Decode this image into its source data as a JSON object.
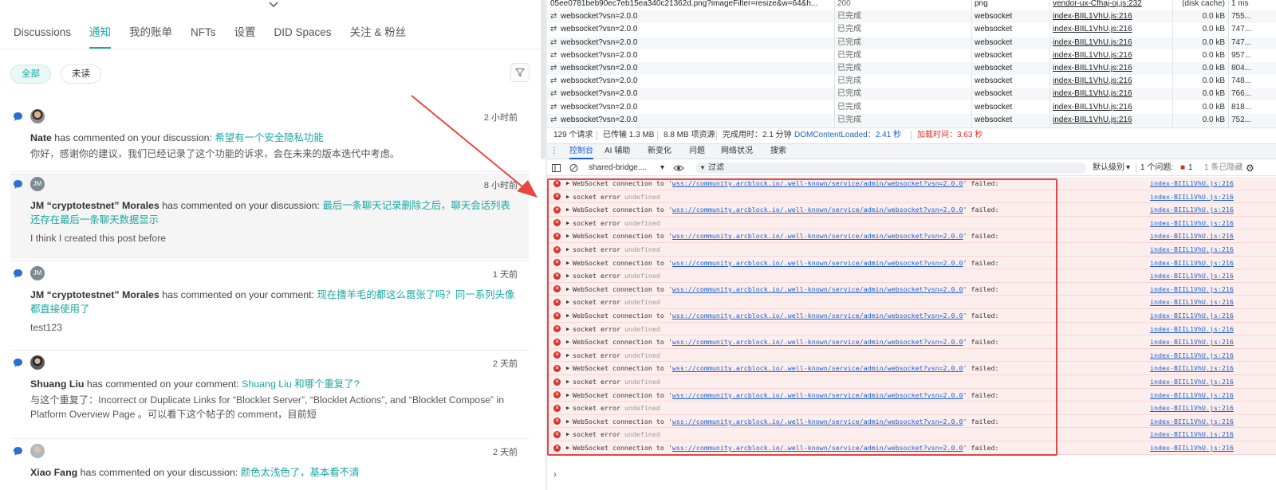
{
  "left": {
    "tabs": [
      {
        "label": "Discussions",
        "active": false
      },
      {
        "label": "通知",
        "active": true
      },
      {
        "label": "我的账单",
        "active": false
      },
      {
        "label": "NFTs",
        "active": false
      },
      {
        "label": "设置",
        "active": false
      },
      {
        "label": "DID Spaces",
        "active": false
      },
      {
        "label": "关注 & 粉丝",
        "active": false
      }
    ],
    "filters": {
      "all": "全部",
      "unread": "未读"
    },
    "accent_color": "#1aa7a3",
    "notifications": [
      {
        "avatar": "photo",
        "initials": "",
        "time": "2 小时前",
        "author": "Nate",
        "action": " has commented on your discussion: ",
        "link": "希望有一个安全隐私功能",
        "body": "你好，感谢你的建议，我们已经记录了这个功能的诉求，会在未来的版本迭代中考虑。",
        "highlighted": false
      },
      {
        "avatar": "init",
        "initials": "JM",
        "time": "8 小时前",
        "author": "JM “cryptotestnet” Morales",
        "action": " has commented on your discussion: ",
        "link": "最后一条聊天记录删除之后，聊天会话列表还存在最后一条聊天数据显示",
        "body": "I think I created this post before",
        "highlighted": true
      },
      {
        "avatar": "init",
        "initials": "JM",
        "time": "1 天前",
        "author": "JM “cryptotestnet” Morales",
        "action": " has commented on your comment: ",
        "link": "现在撸羊毛的都这么嚣张了吗？同一系列头像都直接使用了",
        "body": "test123",
        "highlighted": false
      },
      {
        "avatar": "photo2",
        "initials": "",
        "time": "2 天前",
        "author": "Shuang Liu",
        "action": " has commented on your comment: ",
        "link": "Shuang Liu 和哪个重复了?",
        "body": "与这个重复了：Incorrect or Duplicate Links for “Blocklet Server”, “Blocklet Actions”, and “Blocklet Compose” in Platform Overview Page 。可以看下这个帖子的 comment，目前短",
        "highlighted": false
      },
      {
        "avatar": "photo3",
        "initials": "",
        "time": "2 天前",
        "author": "Xiao Fang",
        "action": " has commented on your discussion: ",
        "link": "颜色太浅色了，基本看不清",
        "body": "",
        "highlighted": false
      }
    ]
  },
  "devtools": {
    "network_rows": [
      {
        "name": "05ee0781beb90ec7eb15ea340c21362d.png?imageFilter=resize&w=64&h...",
        "status": "200",
        "type": "png",
        "initiator": "vendor-ux-Cfhaj-oj.js:232",
        "size": "(disk cache)",
        "time": "1 ms"
      },
      {
        "name": "websocket?vsn=2.0.0",
        "status": "已完成",
        "type": "websocket",
        "initiator": "index-BIIL1VhU.js:216",
        "size": "0.0 kB",
        "time": "755..."
      },
      {
        "name": "websocket?vsn=2.0.0",
        "status": "已完成",
        "type": "websocket",
        "initiator": "index-BIIL1VhU.js:216",
        "size": "0.0 kB",
        "time": "747..."
      },
      {
        "name": "websocket?vsn=2.0.0",
        "status": "已完成",
        "type": "websocket",
        "initiator": "index-BIIL1VhU.js:216",
        "size": "0.0 kB",
        "time": "747..."
      },
      {
        "name": "websocket?vsn=2.0.0",
        "status": "已完成",
        "type": "websocket",
        "initiator": "index-BIIL1VhU.js:216",
        "size": "0.0 kB",
        "time": "957..."
      },
      {
        "name": "websocket?vsn=2.0.0",
        "status": "已完成",
        "type": "websocket",
        "initiator": "index-BIIL1VhU.js:216",
        "size": "0.0 kB",
        "time": "804..."
      },
      {
        "name": "websocket?vsn=2.0.0",
        "status": "已完成",
        "type": "websocket",
        "initiator": "index-BIIL1VhU.js:216",
        "size": "0.0 kB",
        "time": "748..."
      },
      {
        "name": "websocket?vsn=2.0.0",
        "status": "已完成",
        "type": "websocket",
        "initiator": "index-BIIL1VhU.js:216",
        "size": "0.0 kB",
        "time": "766..."
      },
      {
        "name": "websocket?vsn=2.0.0",
        "status": "已完成",
        "type": "websocket",
        "initiator": "index-BIIL1VhU.js:216",
        "size": "0.0 kB",
        "time": "818..."
      },
      {
        "name": "websocket?vsn=2.0.0",
        "status": "已完成",
        "type": "websocket",
        "initiator": "index-BIIL1VhU.js:216",
        "size": "0.0 kB",
        "time": "752..."
      }
    ],
    "summary": {
      "requests": "129 个请求",
      "transferred": "已传输 1.3 MB",
      "resources": "8.8 MB 项资源",
      "finish": "完成用时：2.1 分钟",
      "dcl": "DOMContentLoaded：2.41 秒",
      "load": "加载时间：3.63 秒"
    },
    "drawer_tabs": [
      "控制台",
      "AI 辅助",
      "新变化",
      "问题",
      "网络状况",
      "搜索"
    ],
    "toolbar": {
      "context": "shared-bridge....",
      "filter_placeholder": "过滤",
      "levels": "默认级别",
      "issues": "1 个问题:",
      "issue_count": "1",
      "hidden": "1 条已隐藏"
    },
    "console": {
      "ws_prefix": "WebSocket connection to '",
      "ws_url": "wss://community.arcblock.io/.well-known/service/admin/websocket?vsn=2.0.0",
      "ws_suffix": "' failed:",
      "sock_text": "socket error ",
      "sock_undef": "undefined",
      "source": "index-BIIL1VhU.js:216",
      "message_count": 21
    }
  }
}
